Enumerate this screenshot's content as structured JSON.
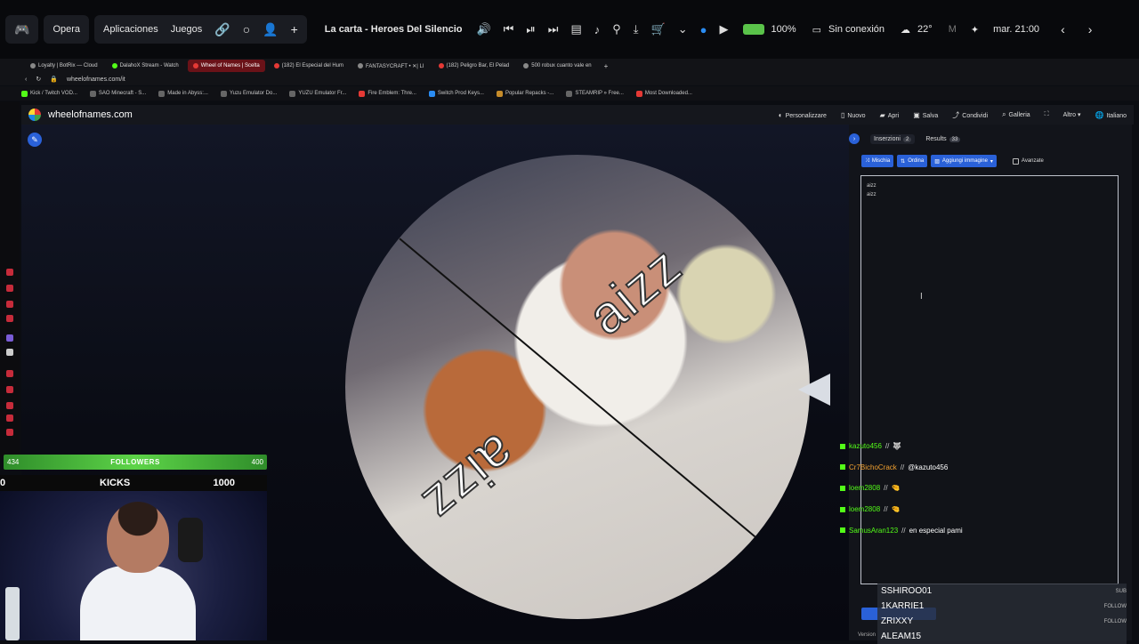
{
  "topbar": {
    "opera": "Opera",
    "aplicaciones": "Aplicaciones",
    "juegos": "Juegos",
    "now_playing": "La carta - Heroes Del Silencio",
    "battery": "100%",
    "network": "Sin conexión",
    "temperature": "22°",
    "datetime": "mar. 21:00"
  },
  "tabs": [
    {
      "label": "Loyalty | BotRix — Cloud"
    },
    {
      "label": "DalahoX Stream - Watch"
    },
    {
      "label": "Wheel of Names | Scelta"
    },
    {
      "label": "(182) El Especial del Hum"
    },
    {
      "label": "FANTASYCRAFT • ✕| LI"
    },
    {
      "label": "(182) Peligro Bar, El Pelad"
    },
    {
      "label": "500 robux cuanto vale en"
    }
  ],
  "url": "wheelofnames.com/it",
  "bookmarks": [
    "Kick / Twitch VOD...",
    "SAO Minecraft - S...",
    "Made in Abyss:...",
    "Yuzu Emulator Do...",
    "YUZU Emulator Fr...",
    "Fire Emblem: Thre...",
    "Switch Prod Keys...",
    "Popular Repacks -...",
    "STEAMRIP » Free...",
    "Most Downloaded..."
  ],
  "site": {
    "logo": "wheelofnames.com",
    "nav": [
      "Personalizzare",
      "Nuovo",
      "Apri",
      "Salva",
      "Condividi",
      "Galleria",
      "Altro",
      "Italiano"
    ]
  },
  "wheel": {
    "segments": [
      "aizz",
      "aizz"
    ]
  },
  "panel": {
    "tab_insertions": "Inserzioni",
    "insertions_count": "2",
    "tab_results": "Results",
    "results_count": "33",
    "shuffle": "Mischia",
    "sort": "Ordina",
    "add_image": "Aggiungi immagine",
    "advanced": "Avanzate",
    "entries": [
      "aizz",
      "aizz"
    ]
  },
  "chat": [
    {
      "user": "kazuto456",
      "msg": "",
      "color": "#53fc18"
    },
    {
      "user": "Cr7BichoCrack",
      "msg": "@kazuto456",
      "color": "#f0a030"
    },
    {
      "user": "loem2808",
      "msg": "",
      "color": "#53fc18"
    },
    {
      "user": "loem2808",
      "msg": "",
      "color": "#53fc18"
    },
    {
      "user": "SamusAran123",
      "msg": "en especial pami",
      "color": "#53fc18"
    }
  ],
  "names_overlay": [
    {
      "name": "SSHIROO01",
      "right": "SUB"
    },
    {
      "name": "1KARRIE1",
      "right": "FOLLOW"
    },
    {
      "name": "ZRIXXY",
      "right": "FOLLOW"
    },
    {
      "name": "ALEAM15",
      "right": ""
    }
  ],
  "version": "Version",
  "stream": {
    "followers_current": "434",
    "followers_label": "FOLLOWERS",
    "followers_goal": "400",
    "kicks_left": "0",
    "kicks_label": "KICKS",
    "kicks_goal": "1000"
  }
}
